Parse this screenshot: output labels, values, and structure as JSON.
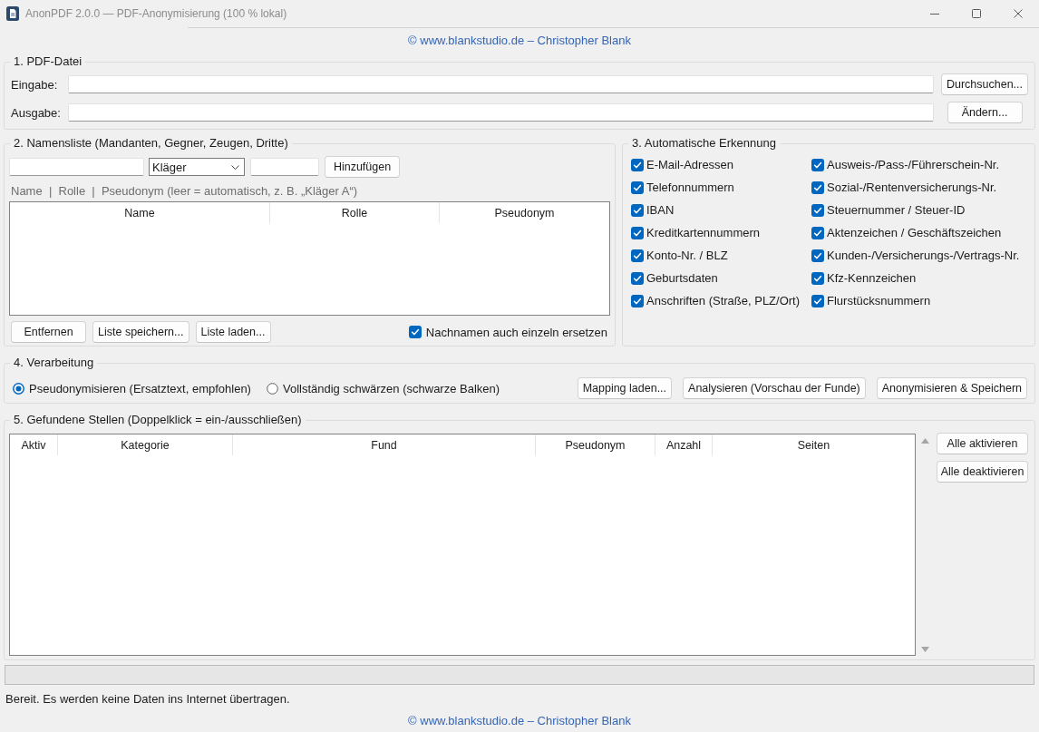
{
  "window": {
    "title": "AnonPDF 2.0.0 — PDF-Anonymisierung (100 % lokal)"
  },
  "header_link": "© www.blankstudio.de – Christopher Blank",
  "pdf_file": {
    "title": "1. PDF-Datei",
    "rows": [
      {
        "label": "Eingabe:",
        "button": "Durchsuchen..."
      },
      {
        "label": "Ausgabe:",
        "button": "Ändern..."
      }
    ]
  },
  "name_list": {
    "title": "2. Namensliste (Mandanten, Gegner, Zeugen, Dritte)",
    "role_select": {
      "value": "Kläger"
    },
    "add_button": "Hinzufügen",
    "hint": "Name  |  Rolle  |  Pseudonym (leer = automatisch, z. B. „Kläger A“)",
    "table": {
      "columns": [
        "Name",
        "Rolle",
        "Pseudonym"
      ]
    },
    "buttons": [
      "Entfernen",
      "Liste speichern...",
      "Liste laden..."
    ],
    "surname_option": {
      "label": "Nachnamen auch einzeln ersetzen",
      "checked": true
    }
  },
  "auto_detection": {
    "title": "3. Automatische Erkennung",
    "columns": [
      {
        "options": [
          {
            "label": "E-Mail-Adressen",
            "checked": true
          },
          {
            "label": "Telefonnummern",
            "checked": true
          },
          {
            "label": "IBAN",
            "checked": true
          },
          {
            "label": "Kreditkartennummern",
            "checked": true
          },
          {
            "label": "Konto-Nr. / BLZ",
            "checked": true
          },
          {
            "label": "Geburtsdaten",
            "checked": true
          },
          {
            "label": "Anschriften (Straße, PLZ/Ort)",
            "checked": true
          }
        ]
      },
      {
        "options": [
          {
            "label": "Ausweis-/Pass-/Führerschein-Nr.",
            "checked": true
          },
          {
            "label": "Sozial-/Rentenversicherungs-Nr.",
            "checked": true
          },
          {
            "label": "Steuernummer / Steuer-ID",
            "checked": true
          },
          {
            "label": "Aktenzeichen / Geschäftszeichen",
            "checked": true
          },
          {
            "label": "Kunden-/Versicherungs-/Vertrags-Nr.",
            "checked": true
          },
          {
            "label": "Kfz-Kennzeichen",
            "checked": true
          },
          {
            "label": "Flurstücksnummern",
            "checked": true
          }
        ]
      }
    ]
  },
  "processing": {
    "title": "4. Verarbeitung",
    "modes": [
      {
        "label": "Pseudonymisieren (Ersatztext, empfohlen)",
        "selected": true
      },
      {
        "label": "Vollständig schwärzen (schwarze Balken)",
        "selected": false
      }
    ],
    "buttons": [
      "Mapping laden...",
      "Analysieren (Vorschau der Funde)",
      "Anonymisieren & Speichern"
    ]
  },
  "findings": {
    "title": "5. Gefundene Stellen (Doppelklick = ein-/ausschließen)",
    "table": {
      "columns": [
        "Aktiv",
        "Kategorie",
        "Fund",
        "Pseudonym",
        "Anzahl",
        "Seiten"
      ]
    },
    "buttons": [
      "Alle aktivieren",
      "Alle deaktivieren"
    ]
  },
  "progress": {
    "level": 0
  },
  "status_bar": "Bereit. Es werden keine Daten ins Internet übertragen.",
  "footer_link": "© www.blankstudio.de – Christopher Blank"
}
